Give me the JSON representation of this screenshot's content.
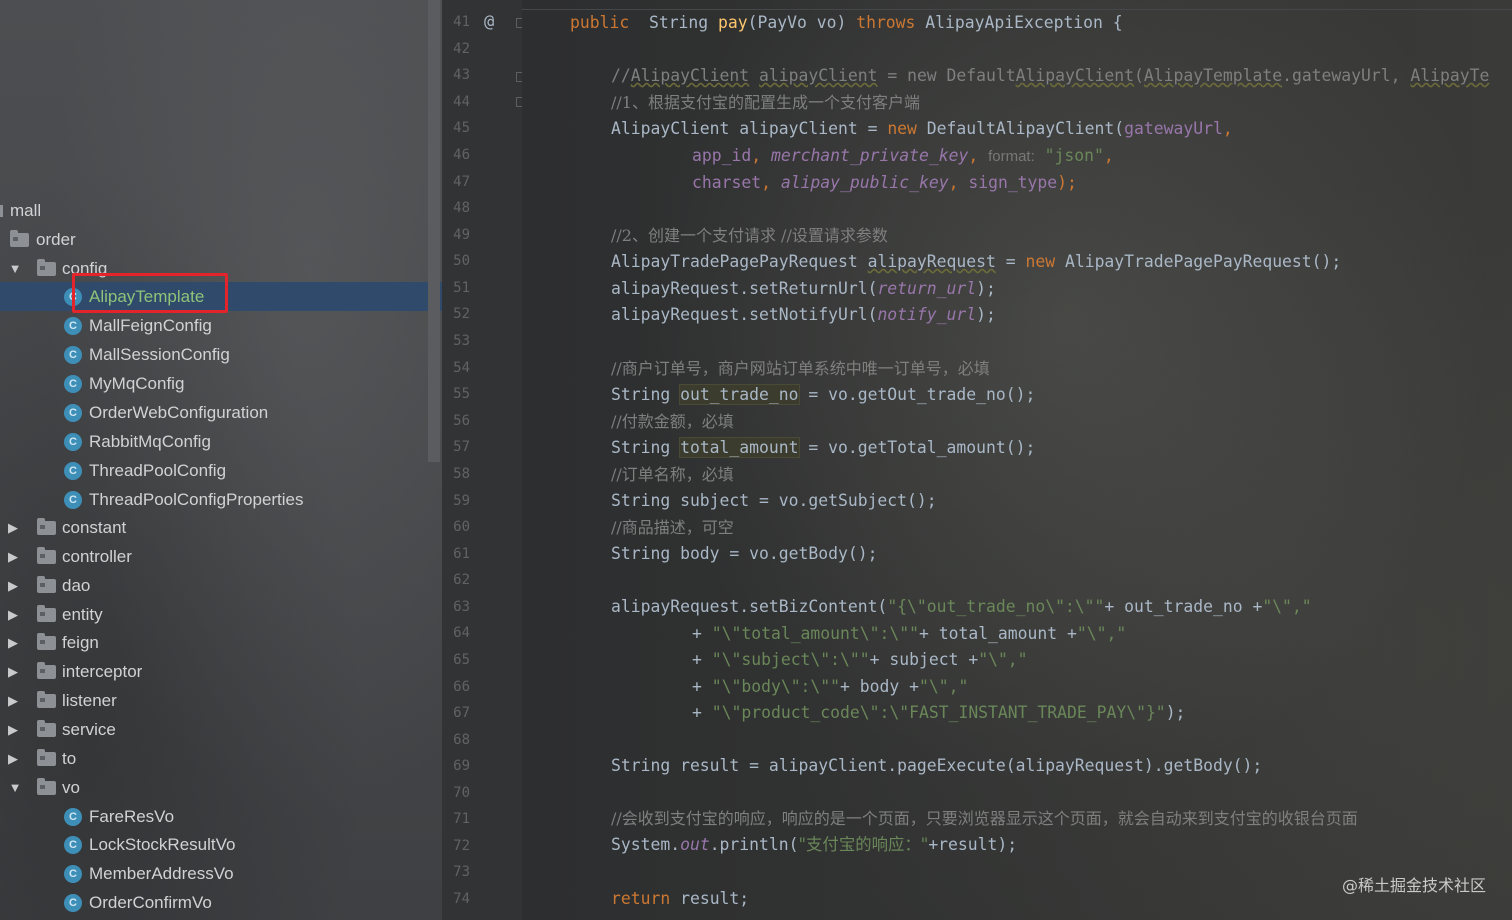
{
  "project_tree": {
    "items": [
      {
        "label": "mall",
        "type": "module"
      },
      {
        "label": "order",
        "type": "folder"
      },
      {
        "label": "config",
        "type": "folder"
      },
      {
        "label": "AlipayTemplate",
        "type": "class"
      },
      {
        "label": "MallFeignConfig",
        "type": "class"
      },
      {
        "label": "MallSessionConfig",
        "type": "class"
      },
      {
        "label": "MyMqConfig",
        "type": "class"
      },
      {
        "label": "OrderWebConfiguration",
        "type": "class"
      },
      {
        "label": "RabbitMqConfig",
        "type": "class"
      },
      {
        "label": "ThreadPoolConfig",
        "type": "class"
      },
      {
        "label": "ThreadPoolConfigProperties",
        "type": "class"
      },
      {
        "label": "constant",
        "type": "folder"
      },
      {
        "label": "controller",
        "type": "folder"
      },
      {
        "label": "dao",
        "type": "folder"
      },
      {
        "label": "entity",
        "type": "folder"
      },
      {
        "label": "feign",
        "type": "folder"
      },
      {
        "label": "interceptor",
        "type": "folder"
      },
      {
        "label": "listener",
        "type": "folder"
      },
      {
        "label": "service",
        "type": "folder"
      },
      {
        "label": "to",
        "type": "folder"
      },
      {
        "label": "vo",
        "type": "folder"
      },
      {
        "label": "FareResVo",
        "type": "class"
      },
      {
        "label": "LockStockResultVo",
        "type": "class"
      },
      {
        "label": "MemberAddressVo",
        "type": "class"
      },
      {
        "label": "OrderConfirmVo",
        "type": "class"
      }
    ],
    "class_icon_letter": "C",
    "selected": "AlipayTemplate"
  },
  "gutter": {
    "line_numbers": [
      "41",
      "42",
      "43",
      "44",
      "45",
      "46",
      "47",
      "48",
      "49",
      "50",
      "51",
      "52",
      "53",
      "54",
      "55",
      "56",
      "57",
      "58",
      "59",
      "60",
      "61",
      "62",
      "63",
      "64",
      "65",
      "66",
      "67",
      "68",
      "69",
      "70",
      "71",
      "72",
      "73",
      "74"
    ],
    "at_marker": "@"
  },
  "code": {
    "l41": {
      "kw1": "public",
      "mid": "  String ",
      "fn": "pay",
      "args": "(PayVo vo) ",
      "kw2": "throws",
      "rest": " AlipayApiException {"
    },
    "l43": {
      "c1": "//",
      "c2": "AlipayClient",
      "c3": " ",
      "c4": "alipayClient",
      "c5": " = new Default",
      "c6": "AlipayClient",
      "c7": "(",
      "c8": "AlipayTemplate",
      "c9": ".gatewayUrl, ",
      "c10": "AlipayTe"
    },
    "l44": "//1、根据支付宝的配置生成一个支付客户端",
    "l45": {
      "a": "AlipayClient alipayClient = ",
      "kw": "new",
      "b": " DefaultAlipayClient(",
      "f": "gatewayUrl",
      ",": ","
    },
    "l46": {
      "f1": "app_id",
      ", ": ", ",
      "f2": "merchant_private_key",
      "c": ", ",
      "hint": "format:",
      "s": " \"json\"",
      "end": ","
    },
    "l47": {
      "f1": "charset",
      "s1": ", ",
      "f2": "alipay_public_key",
      "s2": ", ",
      "f3": "sign_type",
      "end": ");"
    },
    "l49": "//2、创建一个支付请求 //设置请求参数",
    "l50": {
      "a": "AlipayTradePagePayRequest ",
      "b": "alipayRequest",
      "c": " = ",
      "kw": "new",
      "d": " AlipayTradePagePayRequest();"
    },
    "l51": {
      "a": "alipayRequest.setReturnUrl(",
      "f": "return_url",
      "b": ");"
    },
    "l52": {
      "a": "alipayRequest.setNotifyUrl(",
      "f": "notify_url",
      "b": ");"
    },
    "l54": "//商户订单号，商户网站订单系统中唯一订单号，必填",
    "l55": {
      "a": "String ",
      "h": "out_trade_no",
      "b": " = vo.getOut_trade_no();"
    },
    "l56": "//付款金额，必填",
    "l57": {
      "a": "String ",
      "h": "total_amount",
      "b": " = vo.getTotal_amount();"
    },
    "l58": "//订单名称，必填",
    "l59": "String subject = vo.getSubject();",
    "l60": "//商品描述，可空",
    "l61": "String body = vo.getBody();",
    "l63": {
      "a": "alipayRequest.setBizContent(",
      "s": "\"{\\\"out_trade_no\\\":\\\"\"",
      "b": "+ out_trade_no +",
      "s2": "\"\\\",\""
    },
    "l64": {
      "a": "+ ",
      "s": "\"\\\"total_amount\\\":\\\"\"",
      "b": "+ total_amount +",
      "s2": "\"\\\",\""
    },
    "l65": {
      "a": "+ ",
      "s": "\"\\\"subject\\\":\\\"\"",
      "b": "+ subject +",
      "s2": "\"\\\",\""
    },
    "l66": {
      "a": "+ ",
      "s": "\"\\\"body\\\":\\\"\"",
      "b": "+ body +",
      "s2": "\"\\\",\""
    },
    "l67": {
      "a": "+ ",
      "s": "\"\\\"product_code\\\":\\\"FAST_INSTANT_TRADE_PAY\\\"}\"",
      "b": ");"
    },
    "l69": "String result = alipayClient.pageExecute(alipayRequest).getBody();",
    "l71": "//会收到支付宝的响应，响应的是一个页面，只要浏览器显示这个页面，就会自动来到支付宝的收银台页面",
    "l72": {
      "a": "System.",
      "f": "out",
      "b": ".println(",
      "s": "\"支付宝的响应：\"",
      "c": "+result);"
    },
    "l74": {
      "kw": "return",
      "b": " result;"
    }
  },
  "watermark": "@稀土掘金技术社区",
  "colors": {
    "keyword": "#cc7832",
    "string": "#6a8759",
    "comment": "#7f7f7f",
    "field": "#9876aa",
    "method": "#ffc66d",
    "text": "#a9b7c6",
    "selection": "#2f4a6b",
    "highlight_box": "#e3252b",
    "class_icon": "#3e8fb8"
  }
}
